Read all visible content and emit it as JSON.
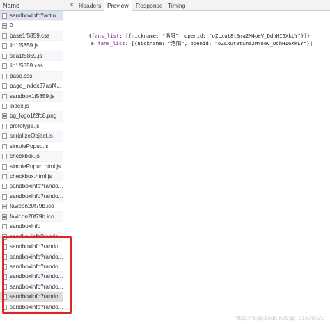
{
  "left_panel": {
    "header": "Name",
    "requests": [
      {
        "label": "sandboxinfo?actio...",
        "icon": "document-icon",
        "state": "selected"
      },
      {
        "label": "0",
        "icon": "image-icon",
        "state": "normal"
      },
      {
        "label": "base1f5859.css",
        "icon": "document-icon",
        "state": "alt"
      },
      {
        "label": "lib1f5859.js",
        "icon": "document-icon",
        "state": "normal"
      },
      {
        "label": "sea1f5859.js",
        "icon": "document-icon",
        "state": "alt"
      },
      {
        "label": "lib1f5859.css",
        "icon": "document-icon",
        "state": "normal"
      },
      {
        "label": "base.css",
        "icon": "document-icon",
        "state": "alt"
      },
      {
        "label": "page_index27aaf4...",
        "icon": "document-icon",
        "state": "normal"
      },
      {
        "label": "sandbox1f5859.js",
        "icon": "document-icon",
        "state": "alt"
      },
      {
        "label": "index.js",
        "icon": "document-icon",
        "state": "normal"
      },
      {
        "label": "bg_logo1f2fc8.png",
        "icon": "image-icon",
        "state": "alt"
      },
      {
        "label": "prototype.js",
        "icon": "document-icon",
        "state": "normal"
      },
      {
        "label": "serializeObject.js",
        "icon": "document-icon",
        "state": "alt"
      },
      {
        "label": "simplePopup.js",
        "icon": "document-icon",
        "state": "normal"
      },
      {
        "label": "checkbox.js",
        "icon": "document-icon",
        "state": "alt"
      },
      {
        "label": "simplePopup.html.js",
        "icon": "document-icon",
        "state": "normal"
      },
      {
        "label": "checkbox.html.js",
        "icon": "document-icon",
        "state": "alt"
      },
      {
        "label": "sandboxinfo?rando...",
        "icon": "document-icon",
        "state": "normal"
      },
      {
        "label": "sandboxinfo?rando...",
        "icon": "document-icon",
        "state": "alt"
      },
      {
        "label": "favicon20f79b.ico",
        "icon": "image-icon",
        "state": "normal"
      },
      {
        "label": "favicon20f79b.ico",
        "icon": "image-icon",
        "state": "alt"
      },
      {
        "label": "sandboxinfo",
        "icon": "document-icon",
        "state": "normal"
      },
      {
        "label": "sandboxinfo?rando...",
        "icon": "document-icon",
        "state": "alt"
      },
      {
        "label": "sandboxinfo?rando...",
        "icon": "document-icon",
        "state": "normal"
      },
      {
        "label": "sandboxinfo?rando...",
        "icon": "document-icon",
        "state": "alt"
      },
      {
        "label": "sandboxinfo?rando...",
        "icon": "document-icon",
        "state": "normal"
      },
      {
        "label": "sandboxinfo?rando...",
        "icon": "document-icon",
        "state": "alt"
      },
      {
        "label": "sandboxinfo?rando...",
        "icon": "document-icon",
        "state": "normal"
      },
      {
        "label": "sandboxinfo?rando...",
        "icon": "document-icon",
        "state": "hl-last"
      },
      {
        "label": "sandboxinfo?rando...",
        "icon": "document-icon",
        "state": "normal"
      }
    ]
  },
  "details": {
    "close_icon": "close-icon",
    "close_glyph": "×",
    "tabs": [
      {
        "label": "Headers",
        "active": false
      },
      {
        "label": "Preview",
        "active": true
      },
      {
        "label": "Response",
        "active": false
      },
      {
        "label": "Timing",
        "active": false
      }
    ],
    "preview": {
      "line1": {
        "open": "{",
        "key": "fans_list",
        "rest": ": [{nickname: \"洛阳\", openid: \"oZLxut8tSma2M4oeV_DdhHI6XkLY\"}]}"
      },
      "line2": {
        "triangle": "▶",
        "key": "fans_list",
        "rest": ": [{nickname: \"洛阳\", openid: \"oZLxut8tSma2M4oeV_DdhHI6XkLY\"}]"
      }
    }
  },
  "watermark": "https://blog.csdn.net/qq_31670725",
  "colors": {
    "highlight_box": "#e02424",
    "key": "#881391",
    "selected_row": "#dde3ee"
  }
}
